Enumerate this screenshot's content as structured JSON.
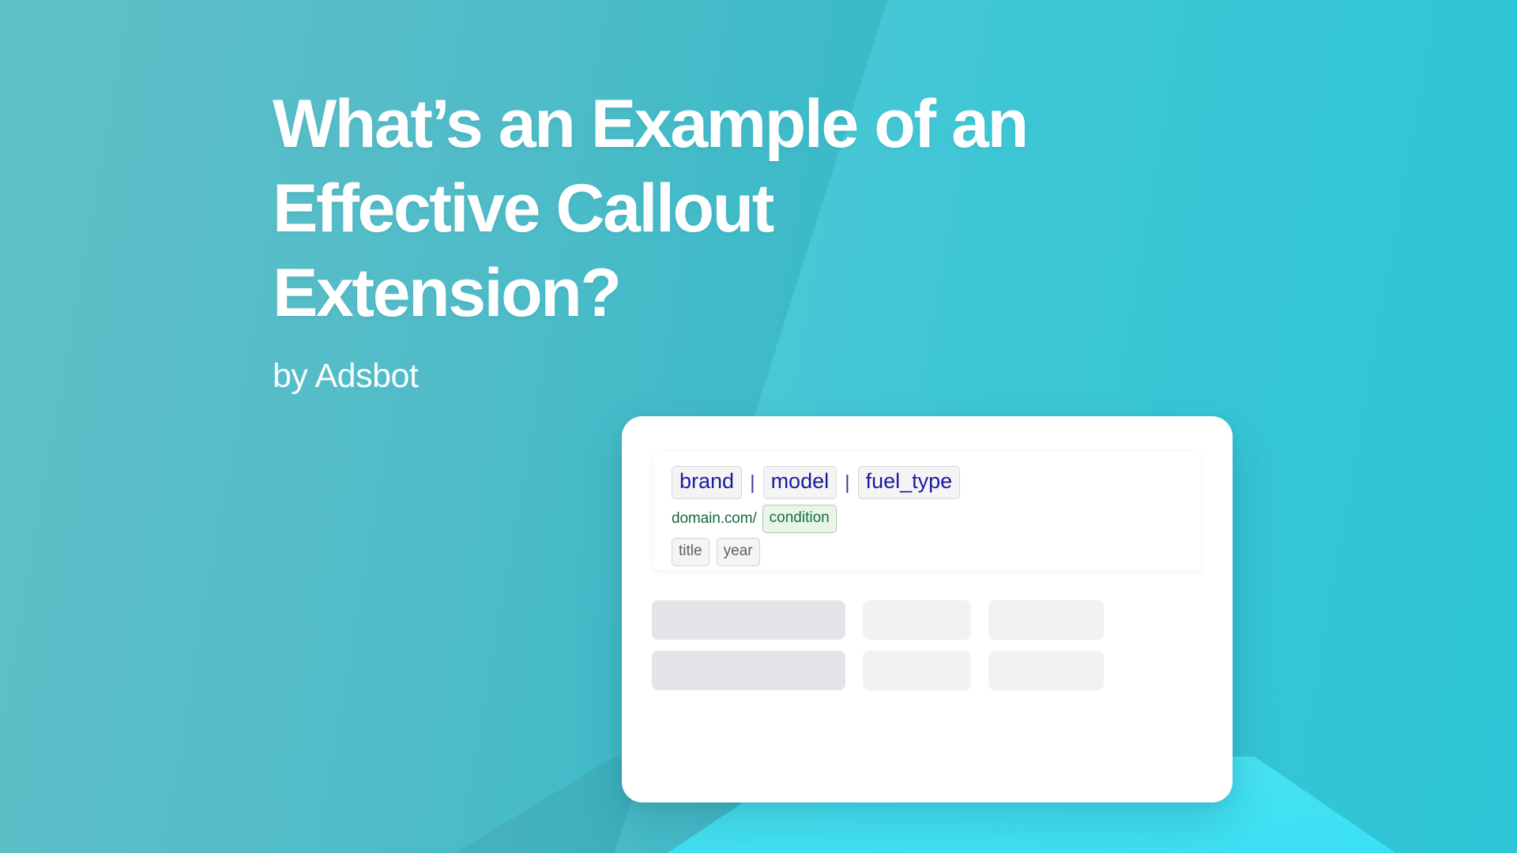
{
  "theme": {
    "bg_left": "#66CBD4",
    "bg_right": "#23C3D4",
    "accent_cyan": "#45E2F3",
    "card_bg": "#FFFFFF",
    "headline_color": "#FFFFFF",
    "tag_navy": "#1a1a9c",
    "tag_green": "#15713f",
    "tag_gray": "#5d6064",
    "skeleton_dark": "#e3e4e8",
    "skeleton_light": "#f1f2f4"
  },
  "headline": {
    "line1": "What’s an Example of an",
    "line2": "Effective Callout",
    "line3": "Extension?"
  },
  "byline": {
    "text": "by Adsbot"
  },
  "ad_preview": {
    "headline_parts": [
      {
        "label": "brand"
      },
      {
        "label": "model"
      },
      {
        "label": "fuel_type"
      }
    ],
    "separator": "|",
    "url_prefix": "domain.com/",
    "url_token": "condition",
    "description_tokens": [
      {
        "label": "title"
      },
      {
        "label": "year"
      }
    ]
  },
  "skeleton": {
    "rows": [
      [
        {
          "tone": "dark"
        },
        {
          "tone": "light"
        },
        {
          "tone": "light"
        }
      ],
      [
        {
          "tone": "dark"
        },
        {
          "tone": "light"
        },
        {
          "tone": "light"
        }
      ]
    ]
  }
}
